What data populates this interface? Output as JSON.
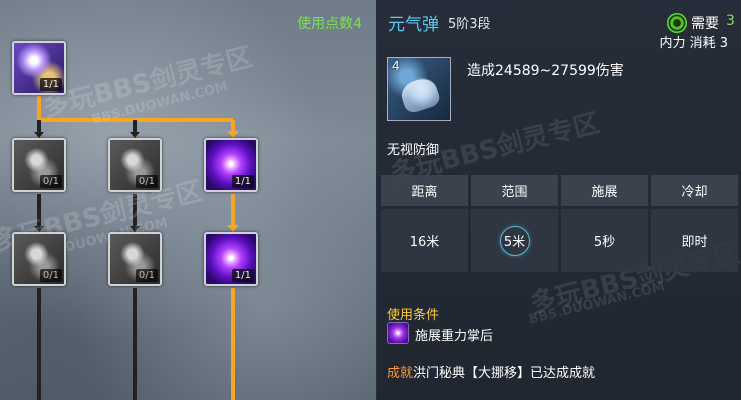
{
  "tree": {
    "points_label": "使用点数4",
    "nodes": [
      {
        "count": "1/1"
      },
      {
        "count": "0/1"
      },
      {
        "count": "0/1"
      },
      {
        "count": "1/1"
      },
      {
        "count": "0/1"
      },
      {
        "count": "0/1"
      },
      {
        "count": "1/1"
      }
    ]
  },
  "watermark": {
    "main": "多玩BBS剑灵专区",
    "url": "BBS.DUOWAN.COM"
  },
  "detail": {
    "title": "元气弹",
    "rank": "5阶3段",
    "need_label": "需要",
    "need_value": "3",
    "cost_label": "内力 消耗",
    "cost_value": "3",
    "icon_level": "4",
    "damage": "造成24589~27599伤害",
    "trait": "无视防御",
    "stats": {
      "headers": [
        "距离",
        "范围",
        "施展",
        "冷却"
      ],
      "values": [
        "16米",
        "5米",
        "5秒",
        "即时"
      ]
    },
    "condition_title": "使用条件",
    "condition_text": "施展重力掌后",
    "achievement_label": "成就",
    "achievement_text": "洪门秘典【大挪移】已达成成就"
  },
  "colors": {
    "accent_blue": "#5ec8f0",
    "points_green": "#7ee05a",
    "path_orange": "#f5a623",
    "condition_yellow": "#ffcc33",
    "achievement_orange": "#ff9a30"
  }
}
